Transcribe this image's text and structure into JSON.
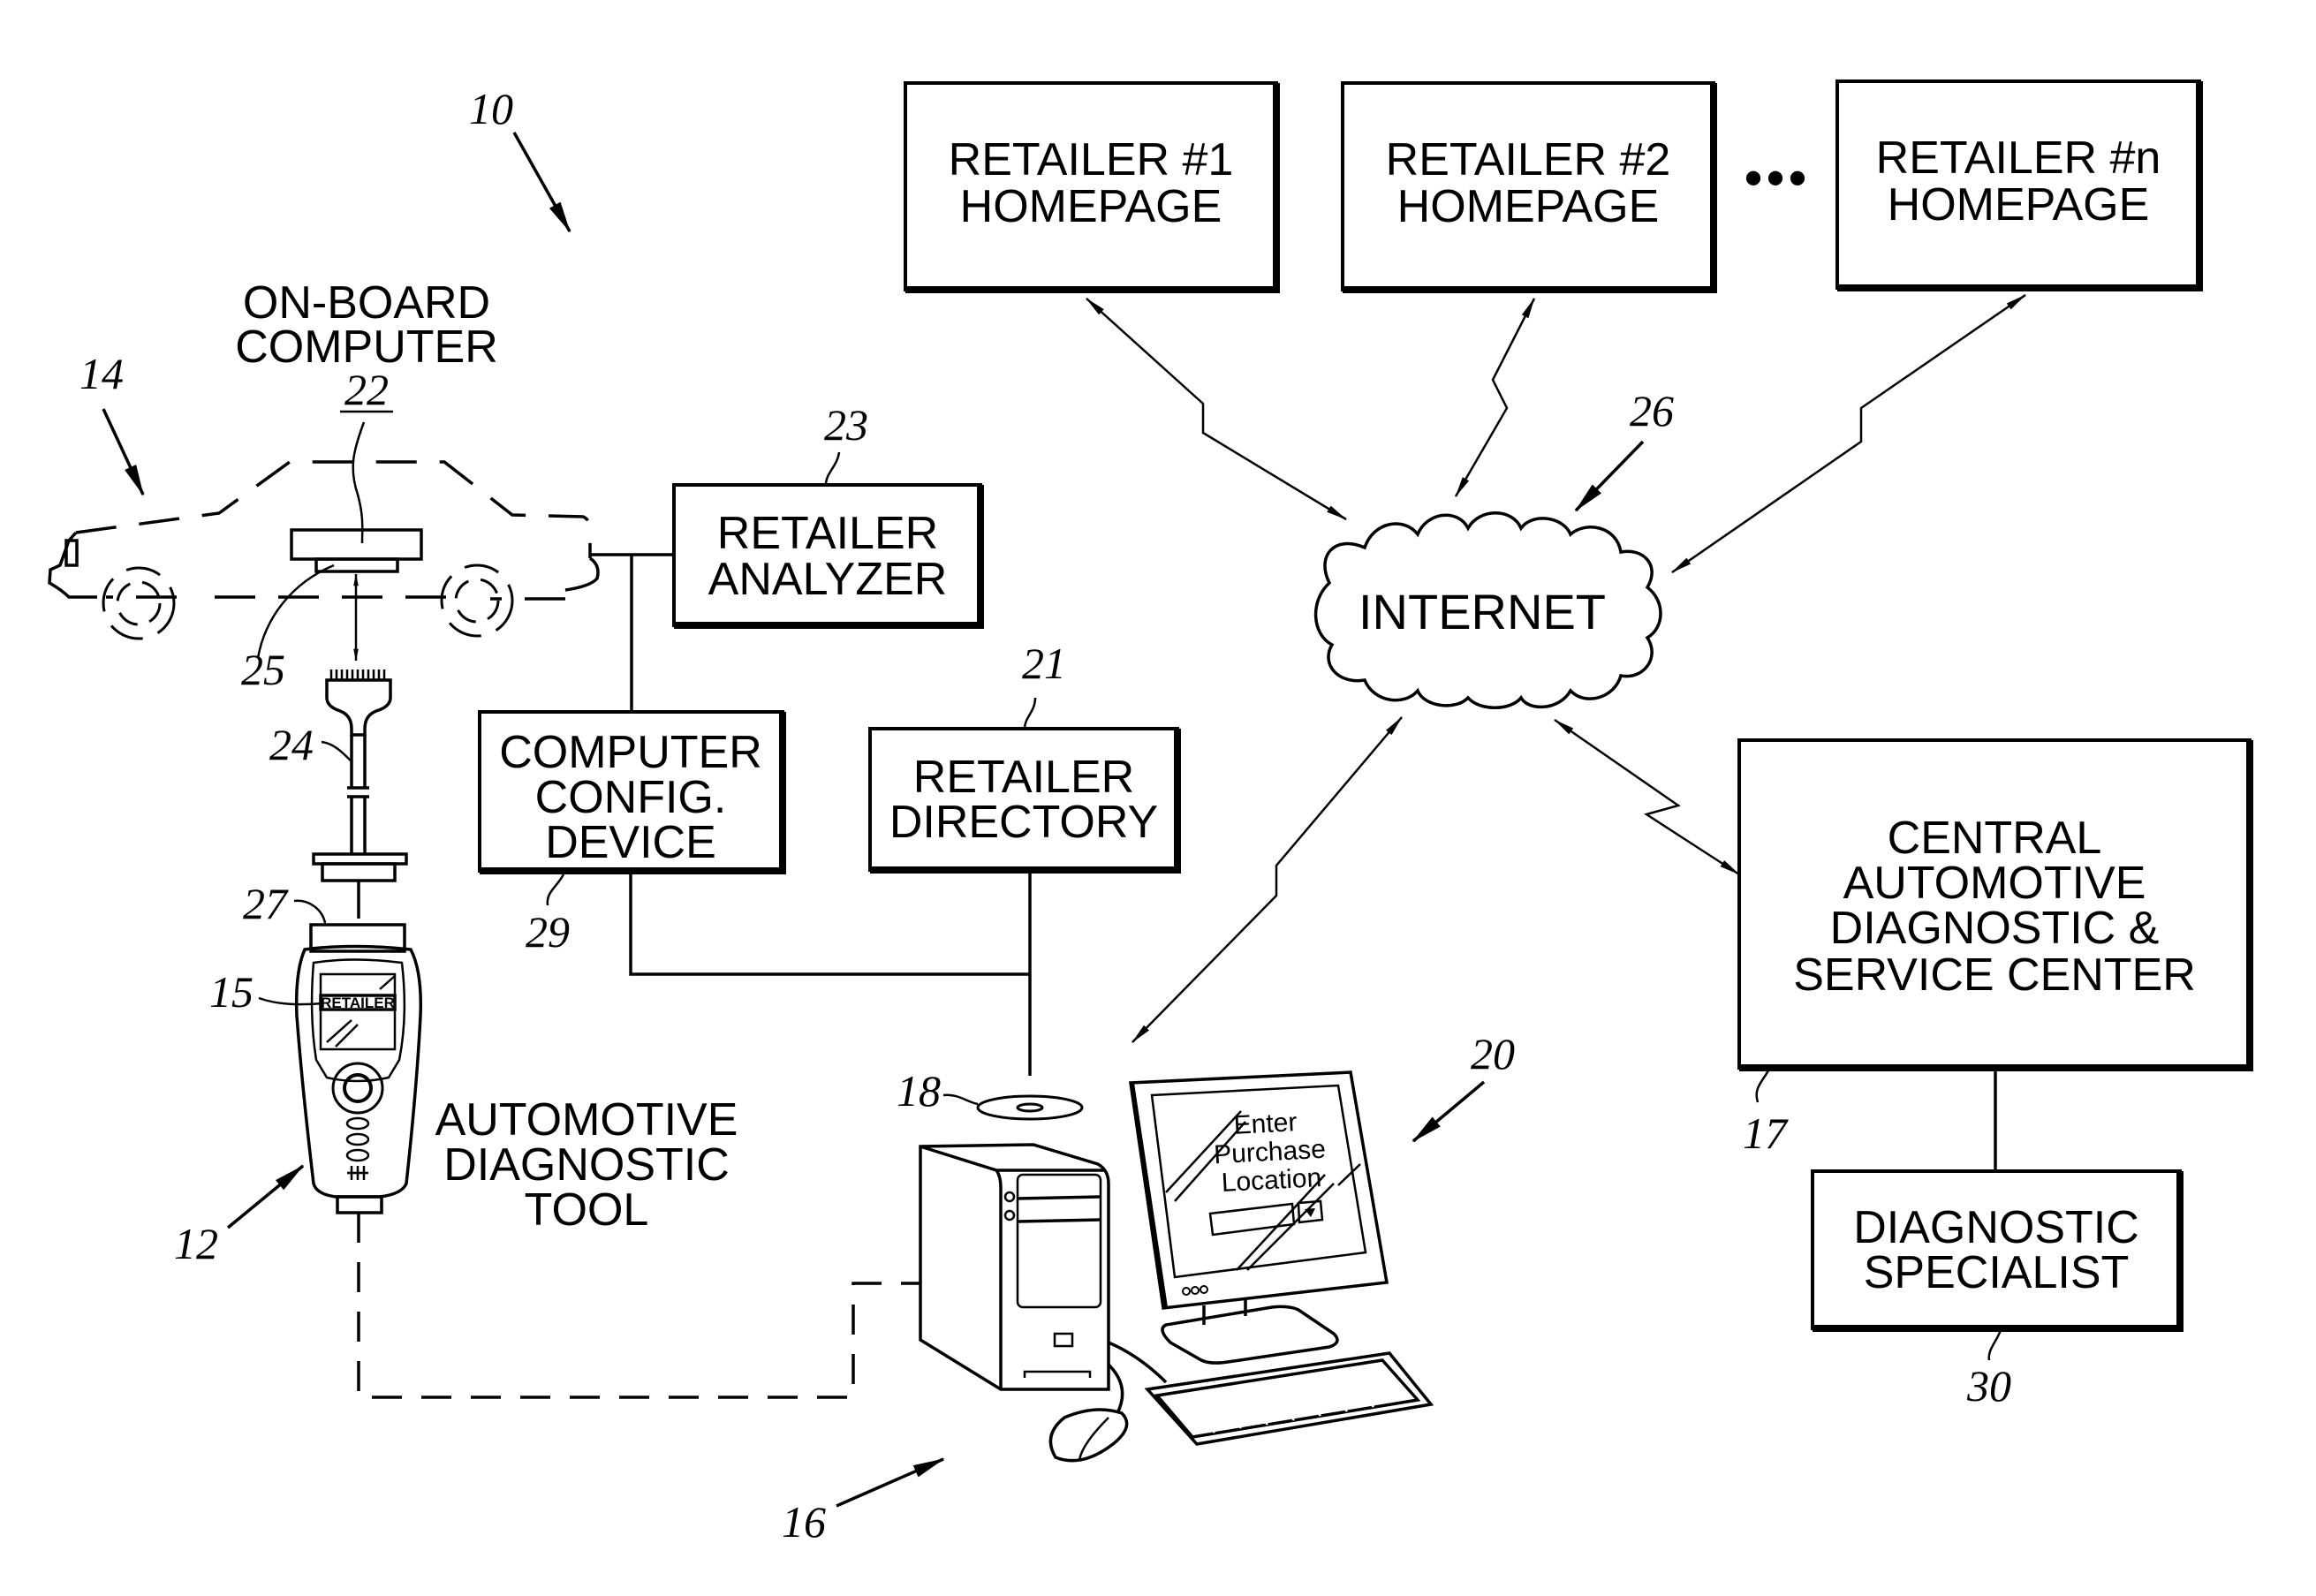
{
  "figure": {
    "reference_numeral": "10",
    "retailers": [
      {
        "line1": "RETAILER #1",
        "line2": "HOMEPAGE"
      },
      {
        "line1": "RETAILER #2",
        "line2": "HOMEPAGE"
      },
      {
        "line1": "RETAILER #n",
        "line2": "HOMEPAGE"
      }
    ],
    "ellipsis": "•••",
    "onboard": {
      "line1": "ON-BOARD",
      "line2": "COMPUTER",
      "ref": "22"
    },
    "vehicle_ref": "14",
    "port_ref": "25",
    "cable_ref": "24",
    "tool_connector_ref": "27",
    "tool_display_ref": "15",
    "tool_display_text": "RETAILER",
    "tool_ref": "12",
    "tool_label": {
      "line1": "AUTOMOTIVE",
      "line2": "DIAGNOSTIC",
      "line3": "TOOL"
    },
    "retailer_analyzer": {
      "line1": "RETAILER",
      "line2": "ANALYZER",
      "ref": "23"
    },
    "config_device": {
      "line1": "COMPUTER",
      "line2": "CONFIG.",
      "line3": "DEVICE",
      "ref": "29"
    },
    "retailer_directory": {
      "line1": "RETAILER",
      "line2": "DIRECTORY",
      "ref": "21"
    },
    "disc_ref": "18",
    "internet": {
      "label": "INTERNET",
      "ref": "26"
    },
    "computer": {
      "ref": "16",
      "monitor_ref": "20",
      "screen_line1": "Enter",
      "screen_line2": "Purchase",
      "screen_line3": "Location"
    },
    "central_center": {
      "line1": "CENTRAL",
      "line2": "AUTOMOTIVE",
      "line3": "DIAGNOSTIC &",
      "line4": "SERVICE CENTER",
      "ref": "17"
    },
    "specialist": {
      "line1": "DIAGNOSTIC",
      "line2": "SPECIALIST",
      "ref": "30"
    }
  }
}
